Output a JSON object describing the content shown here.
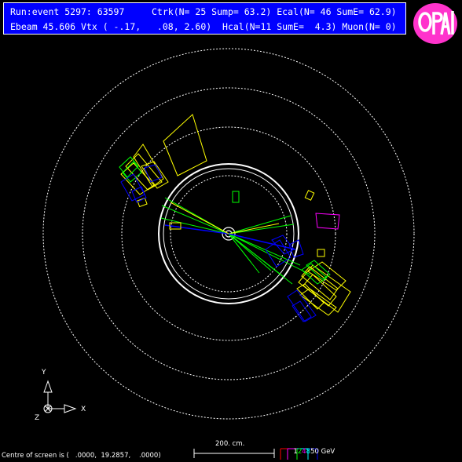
{
  "header": {
    "line1": "Run:event 5297: 63597     Ctrk(N= 25 Sump= 63.2) Ecal(N= 46 SumE= 62.9)",
    "line2": "Ebeam 45.606 Vtx ( -.17,   .08, 2.60)  Hcal(N=11 SumE=  4.3) Muon(N= 0)"
  },
  "logo": {
    "name": "opal-logo",
    "color": "#ff33cc",
    "text": "OPAL"
  },
  "axes": {
    "y_label": "Y",
    "x_label": "X",
    "z_label": "Z"
  },
  "footer": {
    "centre_text": "Centre of screen is (   .0000,  19.2857,    .0000)",
    "scale_label": "200. cm.",
    "energy_digits": [
      "1",
      "2",
      "4",
      "8",
      "50 GeV"
    ],
    "energy_colors": [
      "#ffffff",
      "#00ff00",
      "#ff00ff",
      "#00ffff",
      "#ffffff"
    ]
  },
  "colors": {
    "background": "#000000",
    "header_bg": "#0000ff",
    "track": "#00ff00",
    "ecal": "#ffff00",
    "hcal": "#0000ff",
    "magenta": "#ff00ff",
    "detector_lines": "#ffffff"
  }
}
